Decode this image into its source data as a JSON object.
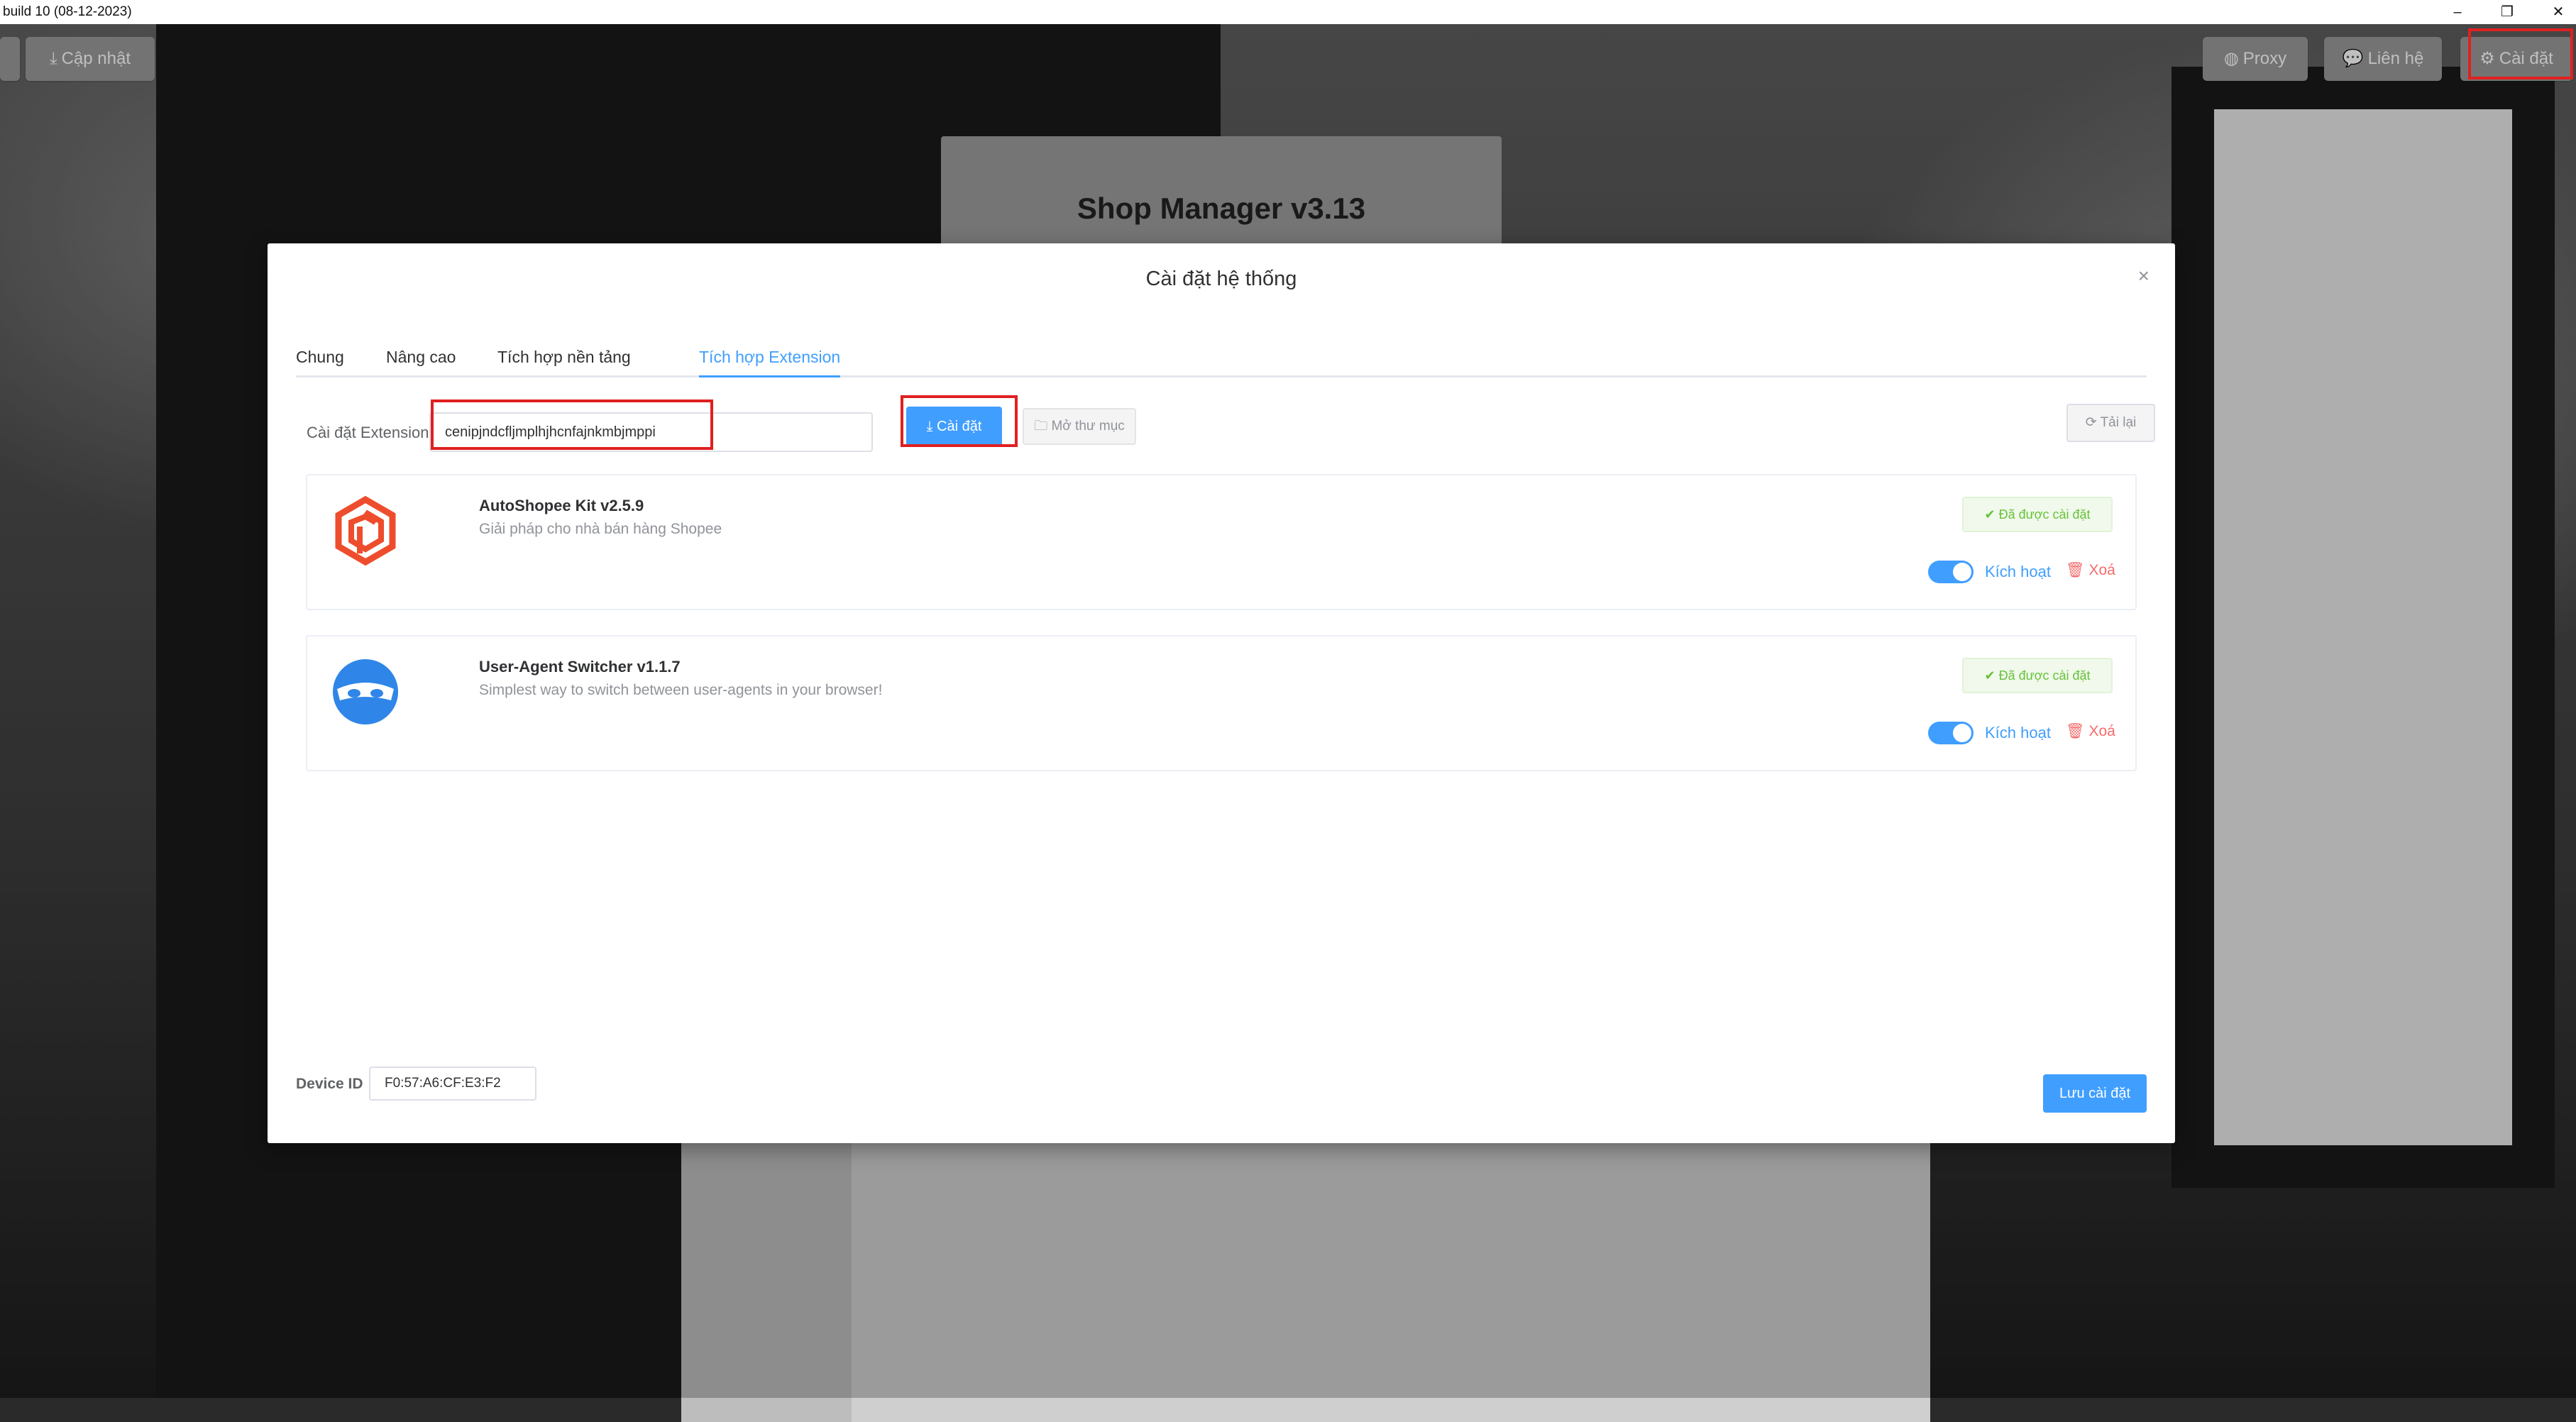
{
  "window": {
    "title": "build 10 (08-12-2023)",
    "minimize_glyph": "–",
    "restore_glyph": "❐",
    "close_glyph": "✕"
  },
  "toolbar": {
    "update_label": "Cập nhật",
    "proxy_label": "Proxy",
    "contact_label": "Liên hệ",
    "settings_label": "Cài đặt"
  },
  "app": {
    "title": "Shop Manager v3.13"
  },
  "modal": {
    "title": "Cài đặt hệ thống",
    "close_glyph": "×",
    "tabs": [
      {
        "label": "Chung"
      },
      {
        "label": "Nâng cao"
      },
      {
        "label": "Tích hợp nền tảng"
      },
      {
        "label": "Tích hợp Extension"
      }
    ],
    "extension_label": "Cài đặt Extension",
    "extension_input_value": "cenipjndcfljmplhjhcnfajnkmbjmppi",
    "install_label": "Cài đặt",
    "open_folder_label": "Mở thư mục",
    "reload_label": "Tải lại",
    "extensions": [
      {
        "name": "AutoShopee Kit v2.5.9",
        "description": "Giải pháp cho nhà bán hàng Shopee",
        "status": "Đã được cài đặt",
        "activate_label": "Kích hoạt",
        "delete_label": "Xoá",
        "enabled": true,
        "icon": "autoshopee-logo-icon"
      },
      {
        "name": "User-Agent Switcher v1.1.7",
        "description": "Simplest way to switch between user-agents in your browser!",
        "status": "Đã được cài đặt",
        "activate_label": "Kích hoạt",
        "delete_label": "Xoá",
        "enabled": true,
        "icon": "mask-logo-icon"
      }
    ],
    "device_id_label": "Device ID",
    "device_id_value": "F0:57:A6:CF:E3:F2",
    "save_label": "Lưu cài đặt"
  },
  "colors": {
    "primary": "#409eff",
    "success": "#67c23a",
    "danger": "#f56c6c",
    "highlight": "#e02020",
    "shopee_orange": "#ee4d2d"
  }
}
